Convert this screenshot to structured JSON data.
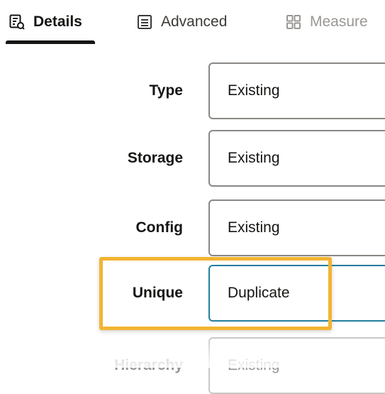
{
  "tabs": [
    {
      "label": "Details",
      "icon": "details-form-icon",
      "selected": true
    },
    {
      "label": "Advanced",
      "icon": "list-icon",
      "selected": false
    },
    {
      "label": "Measure",
      "icon": "grid-icon",
      "selected": false
    }
  ],
  "form": {
    "rows": [
      {
        "label": "Type",
        "value": "Existing"
      },
      {
        "label": "Storage",
        "value": "Existing"
      },
      {
        "label": "Config",
        "value": "Existing"
      },
      {
        "label": "Unique",
        "value": "Duplicate",
        "focused": true,
        "highlighted": true
      },
      {
        "label": "Hierarchy",
        "value": "Existing"
      }
    ]
  },
  "colors": {
    "highlight": "#f2b431",
    "focus_border": "#227e9e",
    "field_border": "#8a8784",
    "text": "#161513"
  }
}
